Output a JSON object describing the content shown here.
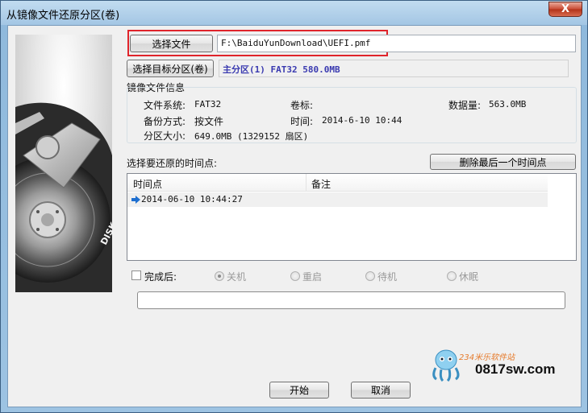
{
  "window": {
    "title": "从镜像文件还原分区(卷)",
    "close_glyph": "X"
  },
  "art": {
    "brand_text": "DISK GENIUS"
  },
  "source": {
    "choose_file_label": "选择文件",
    "file_path": "F:\\BaiduYunDownload\\UEFI.pmf"
  },
  "target": {
    "choose_target_label": "选择目标分区(卷)",
    "target_value": "主分区(1) FAT32 580.0MB"
  },
  "image_info": {
    "group_title": "镜像文件信息",
    "fs_label": "文件系统:",
    "fs_value": "FAT32",
    "volume_label": "卷标:",
    "volume_value": "",
    "data_label": "数据量:",
    "data_value": "563.0MB",
    "backup_label": "备份方式:",
    "backup_value": "按文件",
    "time_label": "时间:",
    "time_value": "2014-6-10 10:44",
    "size_label": "分区大小:",
    "size_value": "649.0MB  (1329152 扇区)"
  },
  "restore_points": {
    "label": "选择要还原的时间点:",
    "delete_button": "删除最后一个时间点",
    "columns": [
      "时间点",
      "备注"
    ],
    "rows": [
      {
        "time": "2014-06-10 10:44:27",
        "note": ""
      }
    ]
  },
  "after": {
    "checkbox_label": "完成后:",
    "checked": false,
    "options": [
      {
        "label": "关机",
        "selected": true
      },
      {
        "label": "重启",
        "selected": false
      },
      {
        "label": "待机",
        "selected": false
      },
      {
        "label": "休眠",
        "selected": false
      }
    ]
  },
  "progress": {
    "fraction": 0
  },
  "actions": {
    "start_label": "开始",
    "cancel_label": "取消"
  },
  "watermark": {
    "site_text": "0817sw.com",
    "cn_text": "234米乐软件站"
  },
  "colors": {
    "highlight": "#e0242b",
    "target_text": "#3a3ab0",
    "arrow": "#1e6fd0"
  }
}
